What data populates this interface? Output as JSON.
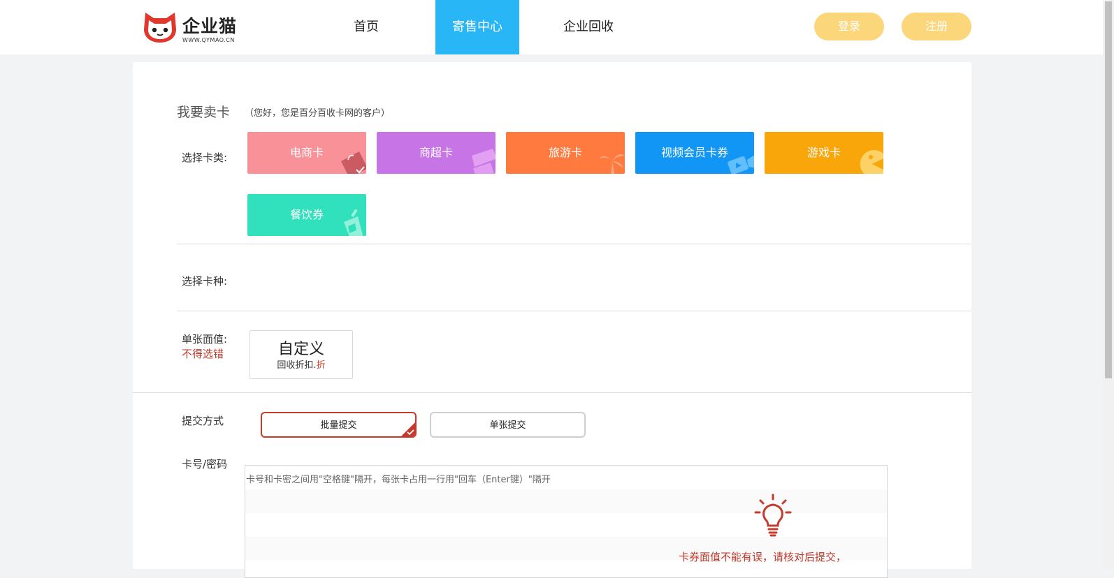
{
  "header": {
    "logo_text": "企业猫",
    "logo_sub": "WWW.QYMAO.CN",
    "nav": [
      {
        "label": "首页"
      },
      {
        "label": "寄售中心"
      },
      {
        "label": "企业回收"
      }
    ],
    "login_label": "登录",
    "register_label": "注册",
    "active_nav_color": "#29b6f6"
  },
  "sell": {
    "title": "我要卖卡",
    "subtitle": "（您好，您是百分百收卡网的客户）",
    "card_type_label": "选择卡类:",
    "card_types": [
      {
        "label": "电商卡",
        "color": "#f99199",
        "icon": "shopping-bag-icon"
      },
      {
        "label": "商超卡",
        "color": "#c774e6",
        "icon": "storefront-icon"
      },
      {
        "label": "旅游卡",
        "color": "#ff7a3f",
        "icon": "palm-tree-icon"
      },
      {
        "label": "视频会员卡券",
        "color": "#1196f5",
        "icon": "video-camera-icon"
      },
      {
        "label": "游戏卡",
        "color": "#f9a60a",
        "icon": "pacman-icon"
      },
      {
        "label": "餐饮券",
        "color": "#31e0bd",
        "icon": "cup-icon"
      }
    ],
    "card_kind_label": "选择卡种:",
    "denomination_label": "单张面值:",
    "denomination_warning": "不得选错",
    "denomination_option": {
      "title": "自定义",
      "rate_prefix": "回收折扣.",
      "rate_suffix": "折"
    },
    "submit_method_label": "提交方式",
    "submit_methods": [
      {
        "label": "批量提交",
        "selected": true
      },
      {
        "label": "单张提交",
        "selected": false
      }
    ],
    "card_code_label": "卡号/密码",
    "card_code_placeholder": "卡号和卡密之间用\"空格键\"隔开，每张卡占用一行用\"回车（Enter键）\"隔开",
    "notice": "卡券面值不能有误，请核对后提交，"
  }
}
